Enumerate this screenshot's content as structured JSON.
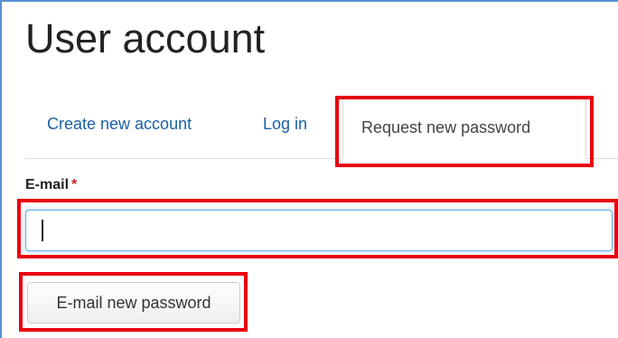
{
  "page": {
    "title": "User account"
  },
  "tabs": {
    "create_account": "Create new account",
    "log_in": "Log in",
    "request_password": "Request new password"
  },
  "form": {
    "email_label": "E-mail",
    "required_marker": "*",
    "email_value": "",
    "submit_label": "E-mail new password"
  },
  "colors": {
    "link": "#1a5fa8",
    "required": "#cc2222",
    "highlight": "#e8000f",
    "focus_border": "#66afe9"
  }
}
